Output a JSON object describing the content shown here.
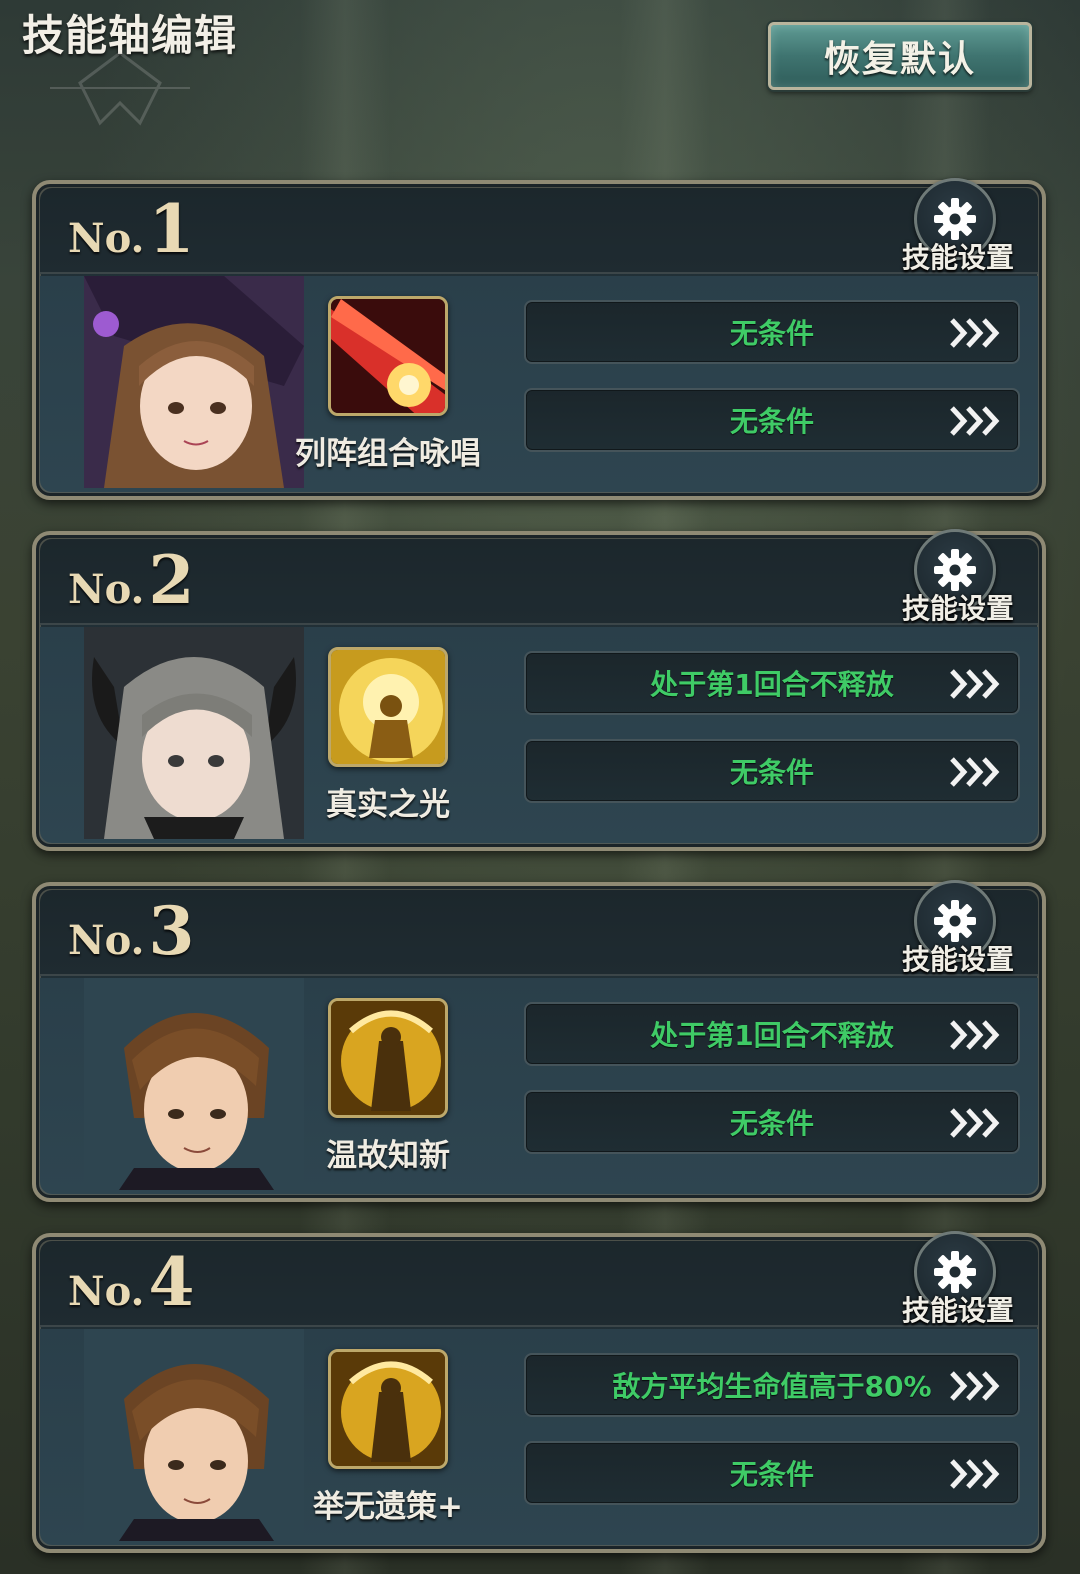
{
  "header": {
    "title": "技能轴编辑",
    "reset_label": "恢复默认"
  },
  "colors": {
    "condition_text": "#3fcb66",
    "gold_label": "#e8d9b4",
    "reset_button": "#4b8680"
  },
  "cards": [
    {
      "no_prefix": "No.",
      "number": "1",
      "settings_label": "技能设置",
      "portrait": "witch-girl-portrait",
      "skill_icon": "red-beam-skill-icon",
      "skill_name": "列阵组合咏唱",
      "conditions": [
        "无条件",
        "无条件"
      ]
    },
    {
      "no_prefix": "No.",
      "number": "2",
      "settings_label": "技能设置",
      "portrait": "horned-girl-portrait",
      "skill_icon": "golden-light-skill-icon",
      "skill_name": "真实之光",
      "conditions": [
        "处于第1回合不释放",
        "无条件"
      ]
    },
    {
      "no_prefix": "No.",
      "number": "3",
      "settings_label": "技能设置",
      "portrait": "brown-haired-man-portrait",
      "skill_icon": "golden-warrior-skill-icon",
      "skill_name": "温故知新",
      "conditions": [
        "处于第1回合不释放",
        "无条件"
      ]
    },
    {
      "no_prefix": "No.",
      "number": "4",
      "settings_label": "技能设置",
      "portrait": "brown-haired-man-portrait",
      "skill_icon": "golden-warrior-skill-icon",
      "skill_name": "举无遗策+",
      "conditions": [
        "敌方平均生命值高于80%",
        "无条件"
      ]
    }
  ]
}
